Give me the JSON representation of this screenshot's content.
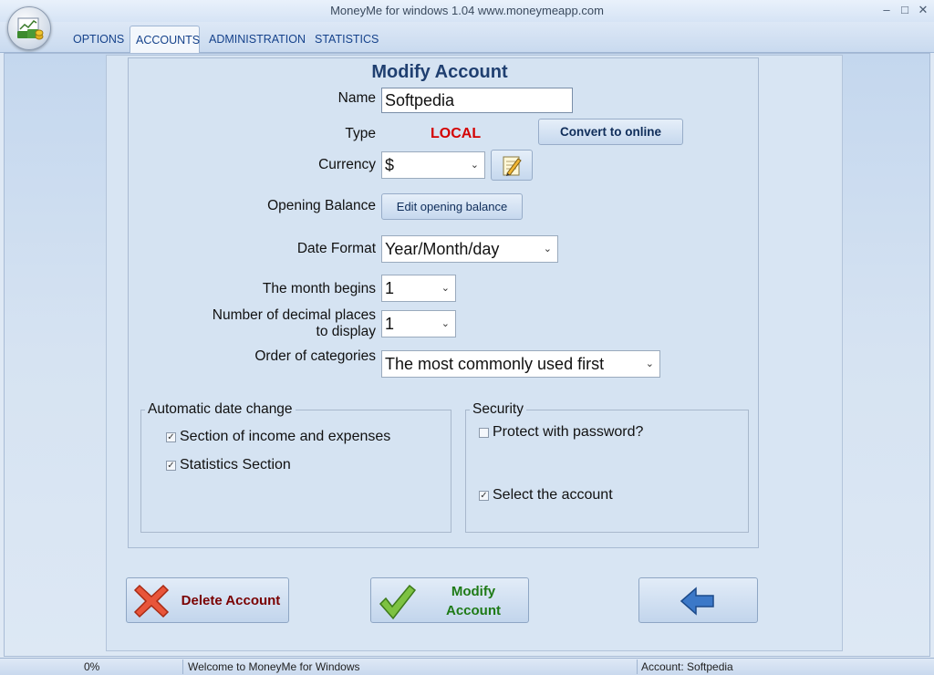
{
  "window": {
    "title": "MoneyMe for windows 1.04 www.moneymeapp.com",
    "controls": {
      "minimize": "–",
      "maximize": "□",
      "close": "✕"
    }
  },
  "app_button": {
    "icon": "money-chart-icon"
  },
  "tabs": [
    {
      "label": "OPTIONS",
      "active": false
    },
    {
      "label": "ACCOUNTS",
      "active": true
    },
    {
      "label": "ADMINISTRATION",
      "active": false
    },
    {
      "label": "STATISTICS",
      "active": false
    }
  ],
  "form": {
    "heading": "Modify Account",
    "name": {
      "label": "Name",
      "value": "Softpedia"
    },
    "type": {
      "label": "Type",
      "value": "LOCAL",
      "convert_button": "Convert to online"
    },
    "currency": {
      "label": "Currency",
      "value": "$",
      "edit_icon": "pencil-notepad-icon"
    },
    "opening_balance": {
      "label": "Opening Balance",
      "button": "Edit opening balance"
    },
    "date_format": {
      "label": "Date Format",
      "value": "Year/Month/day"
    },
    "month_begins": {
      "label": "The month begins",
      "value": "1"
    },
    "decimal_places": {
      "label_line1": "Number of decimal places",
      "label_line2": "to display",
      "value": "1"
    },
    "categories_order": {
      "label": "Order of categories",
      "value": "The most commonly used first"
    },
    "auto_date": {
      "title": "Automatic date change",
      "items": [
        {
          "label": "Section of income and expenses",
          "checked": true
        },
        {
          "label": "Statistics Section",
          "checked": true
        }
      ]
    },
    "security": {
      "title": "Security",
      "items": [
        {
          "label": "Protect with password?",
          "checked": false
        },
        {
          "label": "Select the account",
          "checked": true
        }
      ]
    }
  },
  "actions": {
    "delete": {
      "label": "Delete Account",
      "icon": "red-x-icon"
    },
    "modify": {
      "line1": "Modify",
      "line2": "Account",
      "icon": "green-check-icon"
    },
    "back": {
      "icon": "blue-left-arrow-icon"
    }
  },
  "status": {
    "progress": "0%",
    "message": "Welcome to MoneyMe for Windows",
    "account": "Account: Softpedia"
  },
  "colors": {
    "accent": "#1f3f70",
    "type_local": "#d40000",
    "delete_text": "#7a0000",
    "modify_text": "#1e7a16"
  }
}
